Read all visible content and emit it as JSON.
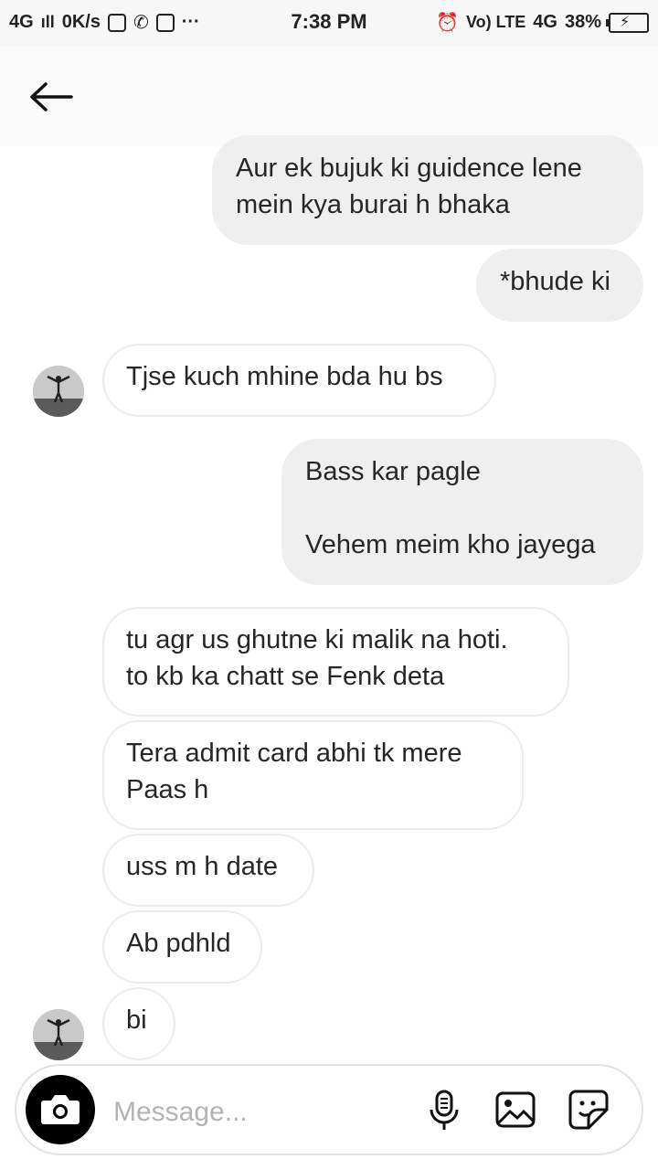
{
  "status_bar": {
    "network": "4G",
    "speed": "0K/s",
    "time": "7:38 PM",
    "volte": "Vo) LTE",
    "network_right": "4G",
    "battery": "38%"
  },
  "messages": [
    {
      "dir": "out",
      "text": "Aur ek bujuk ki guidence lene\nmein kya burai h bhaka"
    },
    {
      "dir": "out",
      "text": "*bhude ki"
    },
    {
      "dir": "in",
      "text": "Tjse kuch mhine bda hu bs"
    },
    {
      "dir": "out",
      "text": "Bass kar pagle\n\nVehem meim kho jayega"
    },
    {
      "dir": "in",
      "text": "tu agr us ghutne ki malik na hoti.\nto kb ka chatt se Fenk deta"
    },
    {
      "dir": "in",
      "text": "Tera admit card abhi tk mere\nPaas h"
    },
    {
      "dir": "in",
      "text": "uss m h date"
    },
    {
      "dir": "in",
      "text": "Ab pdhld"
    },
    {
      "dir": "in",
      "text": "bi"
    }
  ],
  "composer": {
    "placeholder": "Message..."
  },
  "icons": {
    "back": "arrow-left-icon",
    "camera": "camera-icon",
    "mic": "microphone-icon",
    "gallery": "image-icon",
    "sticker": "sticker-icon"
  }
}
